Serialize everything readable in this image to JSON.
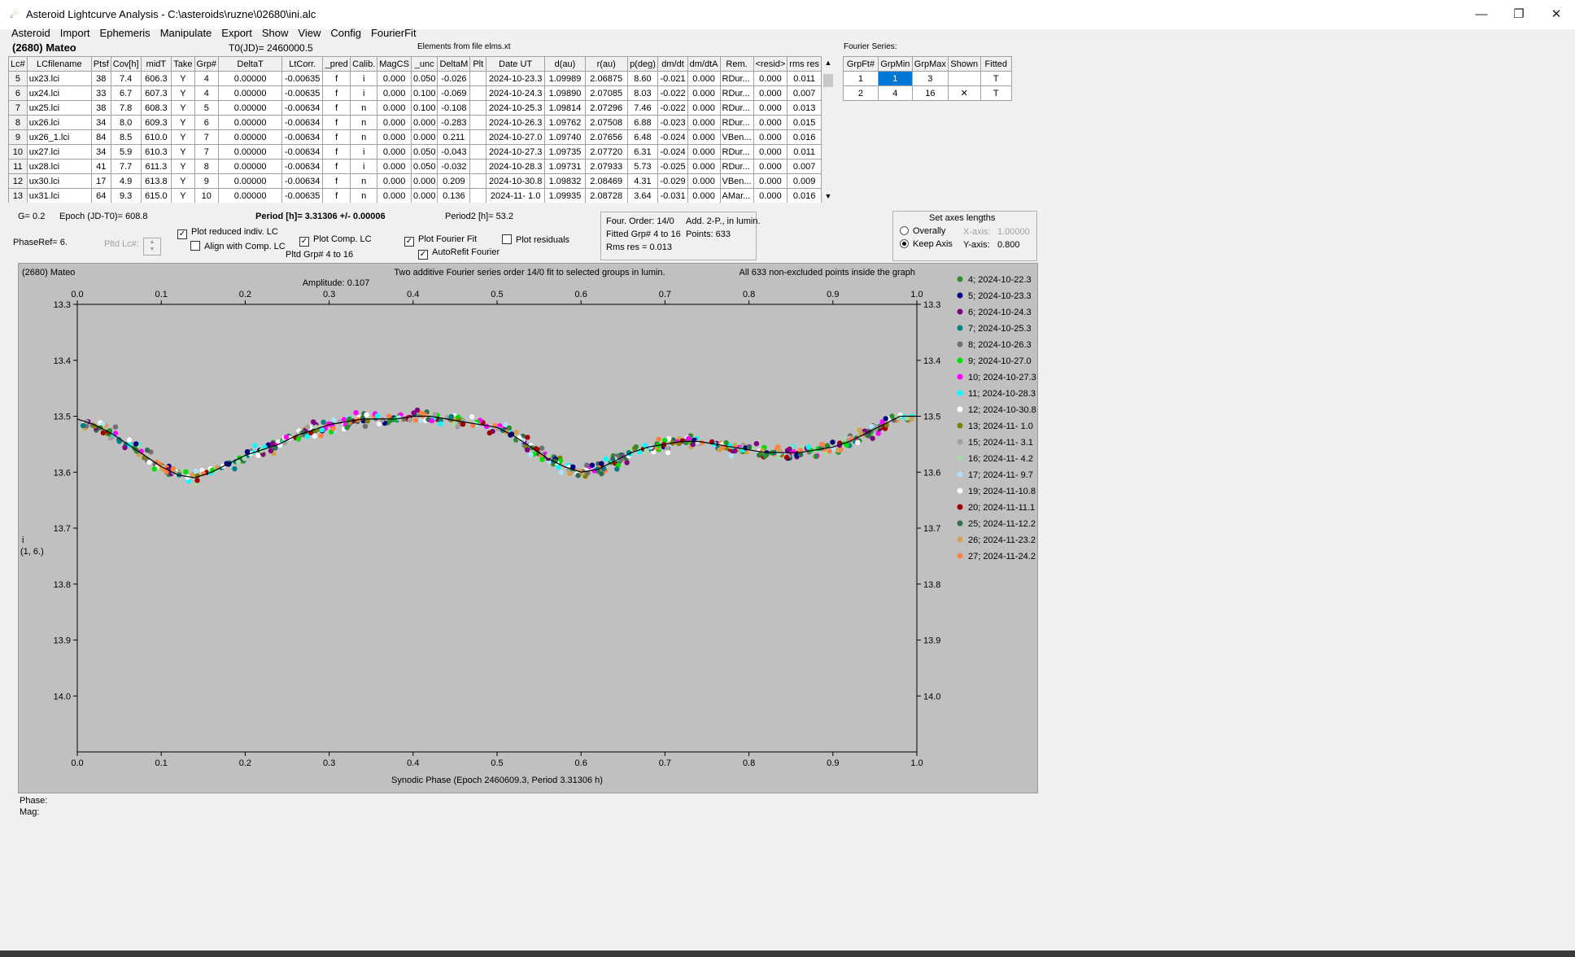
{
  "window": {
    "title": "Asteroid Lightcurve Analysis - C:\\asteroids\\ruzne\\02680\\ini.alc",
    "minimize": "—",
    "restore": "❐",
    "close": "✕"
  },
  "menu": [
    "Asteroid",
    "Import",
    "Ephemeris",
    "Manipulate",
    "Export",
    "Show",
    "View",
    "Config",
    "FourierFit"
  ],
  "header": {
    "asteroid": "(2680) Mateo",
    "t0": "T0(JD)= 2460000.5",
    "elements": "Elements from file elms.xt",
    "fourier_series": "Fourier Series:"
  },
  "lc_table": {
    "columns": [
      "Lc#",
      "LCfilename",
      "Ptsf",
      "Cov[h]",
      "midT",
      "Take",
      "Grp#",
      "DeltaT",
      "LtCorr.",
      "_pred",
      "Calib.",
      "MagCS",
      "_unc",
      "DeltaM",
      "Plt",
      "Date UT",
      "d(au)",
      "r(au)",
      "p(deg)",
      "dm/dt",
      "dm/dtA",
      "Rem.",
      "<resid>",
      "rms res"
    ],
    "rows": [
      [
        "5",
        "ux23.lci",
        "38",
        "7.4",
        "606.3",
        "Y",
        "4",
        "0.00000",
        "-0.00635",
        "f",
        "i",
        "0.000",
        "0.050",
        "-0.026",
        "",
        "2024-10-23.3",
        "1.09989",
        "2.06875",
        "8.60",
        "-0.021",
        "0.000",
        "RDur...",
        "0.000",
        "0.011"
      ],
      [
        "6",
        "ux24.lci",
        "33",
        "6.7",
        "607.3",
        "Y",
        "4",
        "0.00000",
        "-0.00635",
        "f",
        "i",
        "0.000",
        "0.100",
        "-0.069",
        "",
        "2024-10-24.3",
        "1.09890",
        "2.07085",
        "8.03",
        "-0.022",
        "0.000",
        "RDur...",
        "0.000",
        "0.007"
      ],
      [
        "7",
        "ux25.lci",
        "38",
        "7.8",
        "608.3",
        "Y",
        "5",
        "0.00000",
        "-0.00634",
        "f",
        "n",
        "0.000",
        "0.100",
        "-0.108",
        "",
        "2024-10-25.3",
        "1.09814",
        "2.07296",
        "7.46",
        "-0.022",
        "0.000",
        "RDur...",
        "0.000",
        "0.013"
      ],
      [
        "8",
        "ux26.lci",
        "34",
        "8.0",
        "609.3",
        "Y",
        "6",
        "0.00000",
        "-0.00634",
        "f",
        "n",
        "0.000",
        "0.000",
        "-0.283",
        "",
        "2024-10-26.3",
        "1.09762",
        "2.07508",
        "6.88",
        "-0.023",
        "0.000",
        "RDur...",
        "0.000",
        "0.015"
      ],
      [
        "9",
        "ux26_1.lci",
        "84",
        "8.5",
        "610.0",
        "Y",
        "7",
        "0.00000",
        "-0.00634",
        "f",
        "n",
        "0.000",
        "0.000",
        "0.211",
        "",
        "2024-10-27.0",
        "1.09740",
        "2.07656",
        "6.48",
        "-0.024",
        "0.000",
        "VBen...",
        "0.000",
        "0.016"
      ],
      [
        "10",
        "ux27.lci",
        "34",
        "5.9",
        "610.3",
        "Y",
        "7",
        "0.00000",
        "-0.00634",
        "f",
        "i",
        "0.000",
        "0.050",
        "-0.043",
        "",
        "2024-10-27.3",
        "1.09735",
        "2.07720",
        "6.31",
        "-0.024",
        "0.000",
        "RDur...",
        "0.000",
        "0.011"
      ],
      [
        "11",
        "ux28.lci",
        "41",
        "7.7",
        "611.3",
        "Y",
        "8",
        "0.00000",
        "-0.00634",
        "f",
        "i",
        "0.000",
        "0.050",
        "-0.032",
        "",
        "2024-10-28.3",
        "1.09731",
        "2.07933",
        "5.73",
        "-0.025",
        "0.000",
        "RDur...",
        "0.000",
        "0.007"
      ],
      [
        "12",
        "ux30.lci",
        "17",
        "4.9",
        "613.8",
        "Y",
        "9",
        "0.00000",
        "-0.00634",
        "f",
        "n",
        "0.000",
        "0.000",
        "0.209",
        "",
        "2024-10-30.8",
        "1.09832",
        "2.08469",
        "4.31",
        "-0.029",
        "0.000",
        "VBen...",
        "0.000",
        "0.009"
      ],
      [
        "13",
        "ux31.lci",
        "64",
        "9.3",
        "615.0",
        "Y",
        "10",
        "0.00000",
        "-0.00635",
        "f",
        "n",
        "0.000",
        "0.000",
        "0.136",
        "",
        "2024-11- 1.0",
        "1.09935",
        "2.08728",
        "3.64",
        "-0.031",
        "0.000",
        "AMar...",
        "0.000",
        "0.016"
      ]
    ]
  },
  "fourier_table": {
    "columns": [
      "GrpFt#",
      "GrpMin",
      "GrpMax",
      "Shown",
      "Fitted"
    ],
    "rows": [
      [
        "1",
        "1",
        "3",
        "",
        "T"
      ],
      [
        "2",
        "4",
        "16",
        "✕",
        "T"
      ]
    ]
  },
  "controls": {
    "g": "G= 0.2",
    "epoch": "Epoch (JD-T0)= 608.8",
    "period": "Period [h]= 3.31306 +/- 0.00006",
    "period2": "Period2 [h]= 53.2",
    "phase_ref": "PhaseRef= 6.",
    "pltd_lc": "Pltd Lc#:",
    "plot_reduced": "Plot reduced indiv. LC",
    "align_comp": "Align with Comp. LC",
    "plot_comp": "Plot Comp. LC",
    "pltd_grp": "Pltd Grp#  4   to   16",
    "plot_fourier": "Plot Fourier Fit",
    "autorefit": "AutoRefit Fourier",
    "plot_residuals": "Plot residuals",
    "fit_order": "Four. Order: 14/0",
    "fit_add": "Add. 2-P., in lumin.",
    "fit_grp": "Fitted Grp# 4 to 16",
    "fit_points": "Points: 633",
    "fit_rms": "Rms res      = 0.013",
    "axes_title": "Set axes lengths",
    "overally": "Overally",
    "keep_axis": "Keep Axis",
    "x_axis_label": "X-axis:",
    "x_axis_value": "1.00000",
    "y_axis_label": "Y-axis:",
    "y_axis_value": "0.800"
  },
  "chart_data": {
    "type": "scatter",
    "title": "Two additive Fourier series order 14/0 fit to selected groups in lumin.",
    "subtitle": "Amplitude: 0.107",
    "corner_left": "(2680) Mateo",
    "corner_right": "All 633 non-excluded points inside the graph",
    "xlabel": "Synodic Phase (Epoch 2460609.3, Period 3.31306 h)",
    "ylabel": "i",
    "ylabel2": "(1, 6.)",
    "xlim": [
      0.0,
      1.0
    ],
    "ylim": [
      13.3,
      14.1
    ],
    "y_inverted": true,
    "x_ticks": [
      "0.0",
      "0.1",
      "0.2",
      "0.3",
      "0.4",
      "0.5",
      "0.6",
      "0.7",
      "0.8",
      "0.9",
      "1.0"
    ],
    "y_ticks": [
      "13.3",
      "13.4",
      "13.5",
      "13.6",
      "13.7",
      "13.8",
      "13.9",
      "14.0"
    ],
    "grid": false,
    "legend_position": "right",
    "series": [
      {
        "name": "4; 2024-10-22.3",
        "color": "#2e8b2e"
      },
      {
        "name": "5; 2024-10-23.3",
        "color": "#000080"
      },
      {
        "name": "6; 2024-10-24.3",
        "color": "#800080"
      },
      {
        "name": "7; 2024-10-25.3",
        "color": "#008080"
      },
      {
        "name": "8; 2024-10-26.3",
        "color": "#707070"
      },
      {
        "name": "9; 2024-10-27.0",
        "color": "#00e000"
      },
      {
        "name": "10; 2024-10-27.3",
        "color": "#ff00ff"
      },
      {
        "name": "11; 2024-10-28.3",
        "color": "#00ffff"
      },
      {
        "name": "12; 2024-10-30.8",
        "color": "#ffffff"
      },
      {
        "name": "13; 2024-11- 1.0",
        "color": "#808000"
      },
      {
        "name": "15; 2024-11- 3.1",
        "color": "#a0a0a0"
      },
      {
        "name": "16; 2024-11- 4.2",
        "color": "#a8d8a8"
      },
      {
        "name": "17; 2024-11- 9.7",
        "color": "#b0e0ff"
      },
      {
        "name": "19; 2024-11-10.8",
        "color": "#f8f8f8"
      },
      {
        "name": "20; 2024-11-11.1",
        "color": "#a00000"
      },
      {
        "name": "25; 2024-11-12.2",
        "color": "#2f6f4f"
      },
      {
        "name": "26; 2024-11-23.2",
        "color": "#d2a050"
      },
      {
        "name": "27; 2024-11-24.2",
        "color": "#ff8040"
      }
    ],
    "fit_curve": {
      "x": [
        0.0,
        0.02,
        0.04,
        0.06,
        0.08,
        0.1,
        0.12,
        0.14,
        0.16,
        0.18,
        0.2,
        0.22,
        0.24,
        0.26,
        0.28,
        0.3,
        0.32,
        0.34,
        0.36,
        0.38,
        0.4,
        0.42,
        0.44,
        0.46,
        0.48,
        0.5,
        0.52,
        0.54,
        0.56,
        0.58,
        0.6,
        0.62,
        0.64,
        0.66,
        0.68,
        0.7,
        0.72,
        0.74,
        0.76,
        0.78,
        0.8,
        0.82,
        0.84,
        0.86,
        0.88,
        0.9,
        0.92,
        0.94,
        0.96,
        0.98,
        1.0
      ],
      "y": [
        13.505,
        13.515,
        13.53,
        13.55,
        13.57,
        13.59,
        13.605,
        13.61,
        13.6,
        13.585,
        13.57,
        13.56,
        13.55,
        13.535,
        13.525,
        13.515,
        13.51,
        13.505,
        13.505,
        13.505,
        13.5,
        13.5,
        13.505,
        13.51,
        13.515,
        13.52,
        13.535,
        13.555,
        13.575,
        13.59,
        13.6,
        13.595,
        13.58,
        13.565,
        13.555,
        13.55,
        13.545,
        13.545,
        13.55,
        13.555,
        13.56,
        13.565,
        13.565,
        13.565,
        13.56,
        13.555,
        13.545,
        13.53,
        13.515,
        13.5,
        13.5
      ]
    },
    "points_shown": 633
  },
  "status": {
    "phase": "Phase:",
    "mag": "Mag:"
  }
}
